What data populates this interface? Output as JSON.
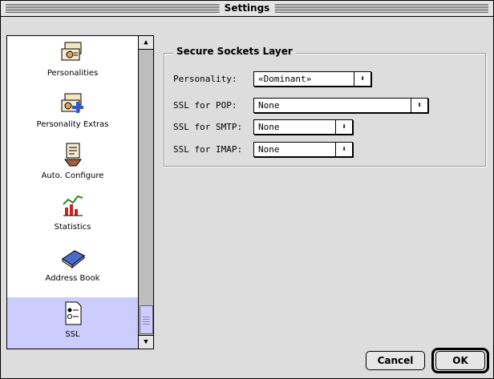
{
  "window": {
    "title": "Settings"
  },
  "sidebar": {
    "items": [
      {
        "label": "Personalities",
        "icon": "personalities-icon"
      },
      {
        "label": "Personality Extras",
        "icon": "personality-extras-icon"
      },
      {
        "label": "Auto. Configure",
        "icon": "auto-configure-icon"
      },
      {
        "label": "Statistics",
        "icon": "statistics-icon"
      },
      {
        "label": "Address Book",
        "icon": "address-book-icon"
      },
      {
        "label": "SSL",
        "icon": "ssl-icon",
        "selected": true
      }
    ]
  },
  "panel": {
    "title": "Secure Sockets Layer",
    "rows": [
      {
        "label": "Personality:",
        "value": "«Dominant»"
      },
      {
        "label": "SSL for POP:",
        "value": "None"
      },
      {
        "label": "SSL for SMTP:",
        "value": "None"
      },
      {
        "label": "SSL for IMAP:",
        "value": "None"
      }
    ]
  },
  "buttons": {
    "cancel": "Cancel",
    "ok": "OK"
  },
  "colors": {
    "selection": "#ccccff",
    "window_bg": "#dddddd"
  }
}
